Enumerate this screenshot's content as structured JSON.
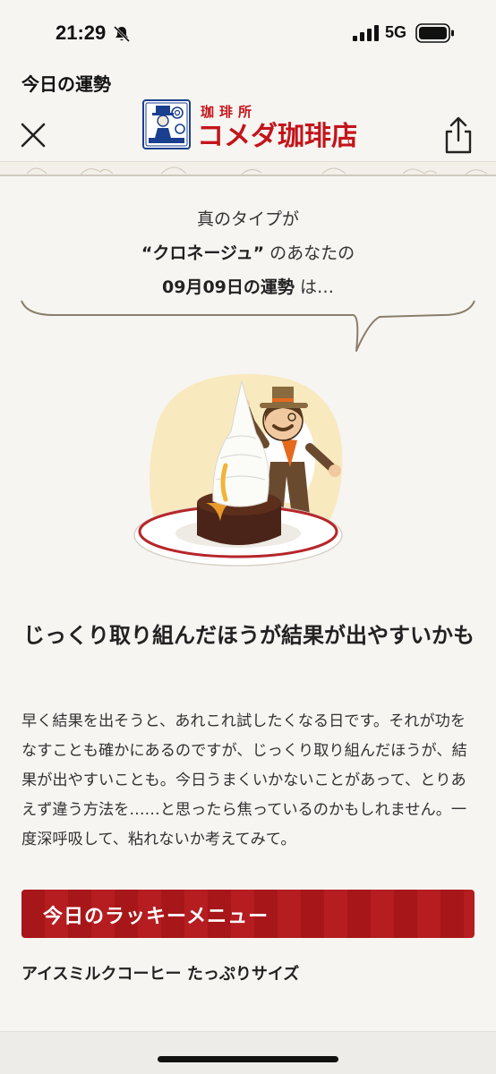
{
  "status_bar": {
    "time": "21:29",
    "network": "5G",
    "icons": [
      "bell-off-icon",
      "signal-bars-icon",
      "battery-icon"
    ]
  },
  "header": {
    "title": "今日の運勢",
    "logo_text": "コメダ珈琲店",
    "logo_sub": "珈琲所",
    "icons": [
      "close-icon",
      "share-icon"
    ]
  },
  "fortune": {
    "intro_line1": "真のタイプが",
    "type_name": "“クロネージュ”",
    "intro_line2_suffix": "のあなたの",
    "date_label": "09月09日の運勢",
    "intro_line3_suffix": "は…",
    "headline": "じっくり取り組んだほうが結果が出やすいかも",
    "body": "早く結果を出そうと、あれこれ試したくなる日です。それが功をなすことも確かにあるのですが、じっくり取り組んだほうが、結果が出やすいことも。今日うまくいかないことがあって、とりあえず違う方法を……と思ったら焦っているのかもしれません。一度深呼吸して、粘れないか考えてみて。"
  },
  "lucky_menu": {
    "heading": "今日のラッキーメニュー",
    "item": "アイスミルクコーヒー たっぷりサイズ"
  },
  "colors": {
    "accent_red": "#a71618",
    "background": "#f7f5f2"
  }
}
